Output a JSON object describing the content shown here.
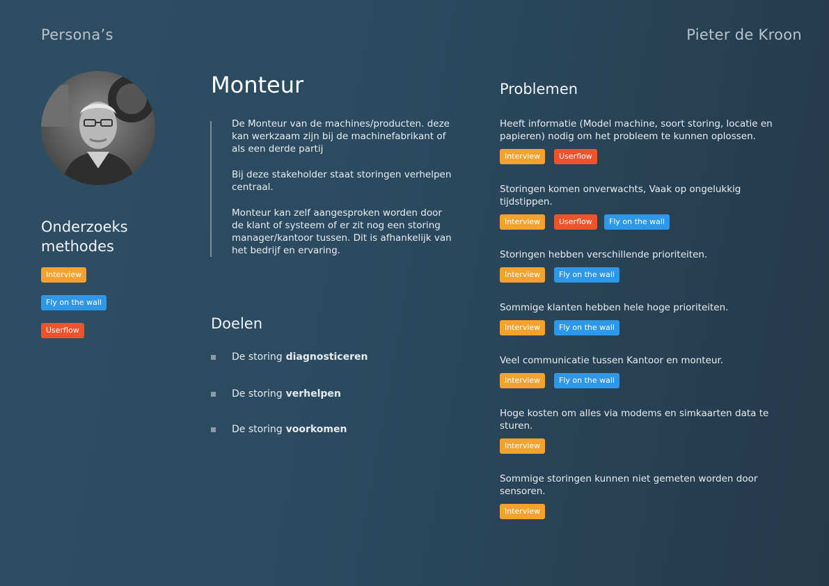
{
  "header": {
    "section": "Persona’s",
    "author": "Pieter de Kroon"
  },
  "persona": {
    "title": "Monteur",
    "description": [
      "De Monteur van de machines/producten. deze kan werkzaam zijn bij de machinefabrikant of als een derde partij",
      "Bij deze stakeholder staat storingen verhelpen centraal.",
      "Monteur kan zelf aangesproken worden door de klant of systeem of er zit nog een storing manager/kantoor tussen. Dit is afhankelijk van het bedrijf en ervaring."
    ]
  },
  "methods": {
    "heading_line1": "Onderzoeks",
    "heading_line2": "methodes",
    "tags": [
      "Interview",
      "Fly on the wall",
      "Userflow"
    ]
  },
  "goals": {
    "heading": "Doelen",
    "items": [
      {
        "prefix": "De storing",
        "bold": "diagnosticeren"
      },
      {
        "prefix": "De storing",
        "bold": "verhelpen"
      },
      {
        "prefix": "De storing",
        "bold": "voorkomen"
      }
    ]
  },
  "problems": {
    "heading": "Problemen",
    "items": [
      {
        "text": "Heeft informatie (Model machine, soort storing,  locatie en papieren) nodig om het probleem te kunnen oplossen.",
        "tags": [
          "Interview",
          "Userflow"
        ]
      },
      {
        "text": "Storingen komen onverwachts, Vaak op  ongelukkig tijdstippen.",
        "tags": [
          "Interview",
          "Userflow",
          "Fly on the wall"
        ]
      },
      {
        "text": "Storingen hebben verschillende prioriteiten.",
        "tags": [
          "Interview",
          "Fly on the wall"
        ]
      },
      {
        "text": "Sommige klanten hebben hele hoge prioriteiten.",
        "tags": [
          "Interview",
          "Fly on the wall"
        ]
      },
      {
        "text": "Veel communicatie tussen Kantoor en monteur.",
        "tags": [
          "Interview",
          "Fly on the wall"
        ]
      },
      {
        "text": "Hoge kosten om alles via modems en simkaarten data te sturen.",
        "tags": [
          "Interview"
        ]
      },
      {
        "text": "Sommige storingen kunnen niet gemeten worden door sensoren.",
        "tags": [
          "Interview"
        ]
      }
    ]
  },
  "colors": {
    "interview": "#f2a22f",
    "userflow": "#f0522c",
    "fly": "#2f97e8"
  }
}
